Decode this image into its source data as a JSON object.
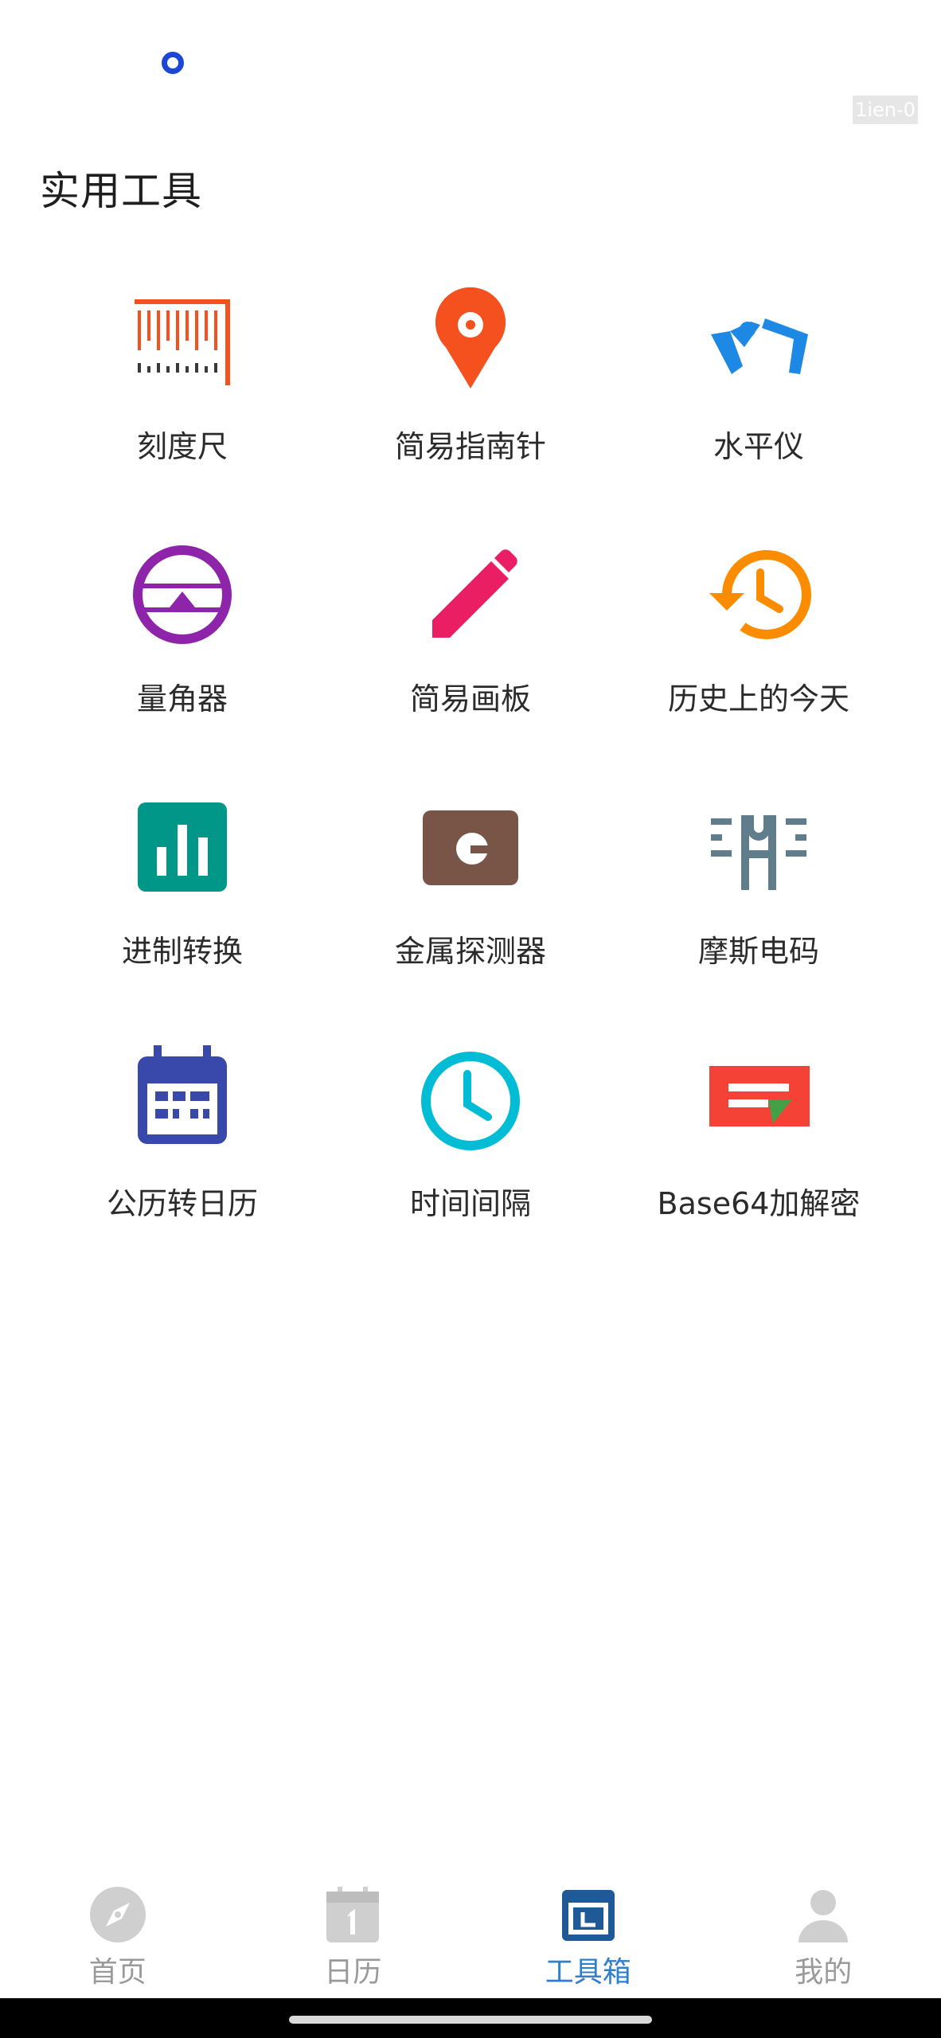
{
  "status": {
    "debug_tag": "1ien-0"
  },
  "page": {
    "title": "实用工具"
  },
  "tools": [
    {
      "label": "刻度尺",
      "icon": "ruler-icon",
      "color": "#f4511e"
    },
    {
      "label": "简易指南针",
      "icon": "location-pin-icon",
      "color": "#f4511e"
    },
    {
      "label": "水平仪",
      "icon": "level-icon",
      "color": "#1e88e5"
    },
    {
      "label": "量角器",
      "icon": "protractor-icon",
      "color": "#8e24aa"
    },
    {
      "label": "简易画板",
      "icon": "pencil-icon",
      "color": "#e91e63"
    },
    {
      "label": "历史上的今天",
      "icon": "history-icon",
      "color": "#fb8c00"
    },
    {
      "label": "进制转换",
      "icon": "bar-chart-icon",
      "color": "#009688"
    },
    {
      "label": "金属探测器",
      "icon": "metal-detector-icon",
      "color": "#795548"
    },
    {
      "label": "摩斯电码",
      "icon": "morse-code-icon",
      "color": "#607d8b"
    },
    {
      "label": "公历转日历",
      "icon": "calendar-icon",
      "color": "#3949ab"
    },
    {
      "label": "时间间隔",
      "icon": "clock-icon",
      "color": "#00bcd4"
    },
    {
      "label": "Base64加解密",
      "icon": "base64-icon",
      "color": "#f44336"
    }
  ],
  "tabbar": {
    "items": [
      {
        "label": "首页",
        "icon": "compass-icon",
        "active": false
      },
      {
        "label": "日历",
        "icon": "calendar-day-icon",
        "active": false
      },
      {
        "label": "工具箱",
        "icon": "toolbox-icon",
        "active": true
      },
      {
        "label": "我的",
        "icon": "user-icon",
        "active": false
      }
    ],
    "active_color": "#2f7fd0",
    "inactive_color": "#9a9a9a"
  }
}
